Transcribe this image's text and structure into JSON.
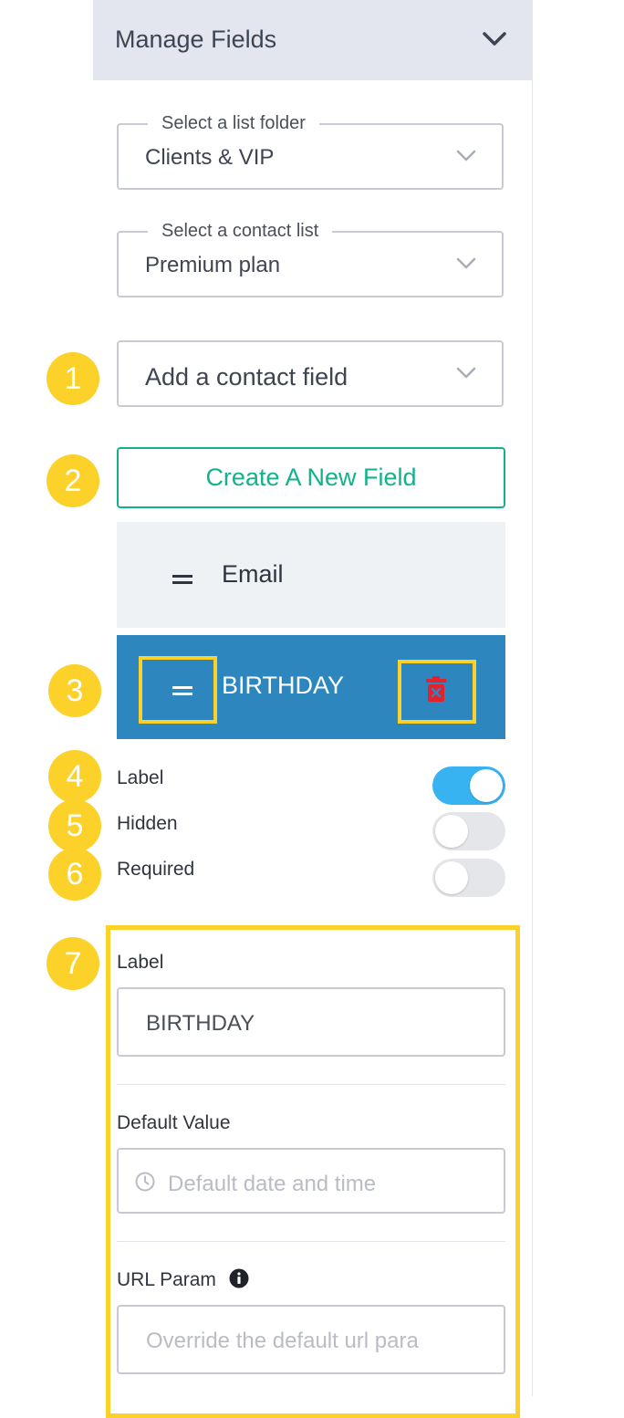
{
  "header": {
    "title": "Manage Fields",
    "chevron_icon": "chevron-down-icon"
  },
  "list_folder": {
    "legend": "Select a list folder",
    "value": "Clients & VIP"
  },
  "contact_list": {
    "legend": "Select a contact list",
    "value": "Premium plan"
  },
  "contact_field": {
    "placeholder": "Add a contact field"
  },
  "create_button": {
    "label": "Create A New Field"
  },
  "fields": [
    {
      "name": "Email",
      "selected": false
    },
    {
      "name": "BIRTHDAY",
      "selected": true
    }
  ],
  "toggles": [
    {
      "label": "Label",
      "on": true
    },
    {
      "label": "Hidden",
      "on": false
    },
    {
      "label": "Required",
      "on": false
    }
  ],
  "settings": {
    "label_title": "Label",
    "label_value": "BIRTHDAY",
    "default_value_title": "Default Value",
    "default_value_placeholder": "Default date and time",
    "url_param_title": "URL Param",
    "url_param_placeholder": "Override the default url para"
  },
  "badges": [
    "1",
    "2",
    "3",
    "4",
    "5",
    "6",
    "7"
  ],
  "colors": {
    "accent_green": "#12b28c",
    "selected_row": "#2e86bf",
    "toggle_on": "#37b3f2",
    "highlight": "#fcd12a",
    "delete_red": "#e0232f"
  }
}
